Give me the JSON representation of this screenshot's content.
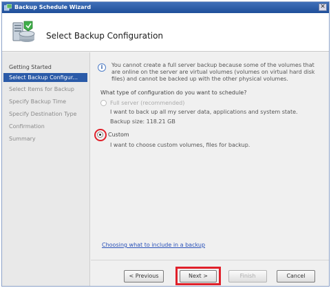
{
  "window": {
    "title": "Backup Schedule Wizard",
    "close_glyph": "✕"
  },
  "header": {
    "title": "Select Backup Configuration",
    "icon": "backup-server-icon"
  },
  "nav": {
    "items": [
      {
        "label": "Getting Started",
        "state": "done"
      },
      {
        "label": "Select Backup Configur...",
        "state": "active"
      },
      {
        "label": "Select Items for Backup",
        "state": "pending"
      },
      {
        "label": "Specify Backup Time",
        "state": "pending"
      },
      {
        "label": "Specify Destination Type",
        "state": "pending"
      },
      {
        "label": "Confirmation",
        "state": "pending"
      },
      {
        "label": "Summary",
        "state": "pending"
      }
    ]
  },
  "content": {
    "info_glyph": "i",
    "info_line1": "You cannot create a full server backup because some of the volumes that",
    "info_line2": "are online on the server are virtual volumes (volumes on virtual hard disk",
    "info_line3": "files) and cannot be backed up with the other physical volumes.",
    "question": "What type of configuration do you want to schedule?",
    "options": [
      {
        "label": "Full server (recommended)",
        "desc": "I want to back up all my server data, applications and system state.",
        "size": "Backup size: 118.21 GB",
        "selected": false,
        "disabled": true
      },
      {
        "label": "Custom",
        "desc": "I want to choose custom volumes, files for backup.",
        "selected": true,
        "disabled": false
      }
    ],
    "link": "Choosing what to include in a backup"
  },
  "buttons": {
    "previous": "< Previous",
    "next": "Next >",
    "finish": "Finish",
    "cancel": "Cancel"
  },
  "colors": {
    "accent": "#2a5aa8",
    "highlight": "#e0202a"
  }
}
